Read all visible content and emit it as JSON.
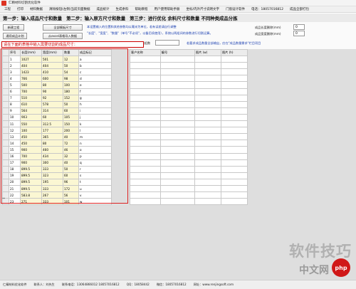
{
  "window": {
    "title": "仁精材料切割优化软件"
  },
  "menu": [
    "工程",
    "打印",
    "材料数据",
    "清除按钮(左侧)当前页面数据",
    "成品统计",
    "生成余料",
    "帮助教程",
    "用户使用帮助手册",
    "坐标/内外尺寸说明文字",
    "门窗设计软件",
    "电话：18057016812",
    "成品全部打包"
  ],
  "steps": [
    "第一步：输入成品尺寸和数量",
    "第二步：输入原方尺寸和数量",
    "第三步：进行优化 余料尺寸和数量 不同种类成品分拣"
  ],
  "controls": {
    "new_project": "新建工程",
    "import_template": "全部模板尺寸",
    "import_plan": "通用成品计划",
    "import_excel": "从excel表格导入数据",
    "desc1": "本设置输入的位置和其他参数均以毫米为单位，若有误差请自行调整",
    "desc2": "\"长度\"、\"宽度\"、\"数量\"（单号\"不必须\"，以备后续使用），系统以两组间的参数进行切割运算。",
    "cut_width_label": "成品长度删除(mm)",
    "cut_width_value": "0",
    "edge_label": "成品宽度删除(mm)",
    "edge_value": "0",
    "count_label": "成品数量组数",
    "hint": "若要求成品数量全部输出，应在\"成品数量需求\"栏目项目",
    "warn": "请在下面的表格中输入需要切割的成品尺寸："
  },
  "left_table": {
    "headers": [
      "序号",
      "长度(mm)",
      "宽度(mm)",
      "数量",
      "成品标记"
    ],
    "rows": [
      [
        "1",
        "1027",
        "501",
        "12",
        "a"
      ],
      [
        "2",
        "404",
        "404",
        "50",
        "b"
      ],
      [
        "3",
        "1423",
        "410",
        "54",
        "c"
      ],
      [
        "4",
        "766",
        "600",
        "98",
        "d"
      ],
      [
        "5",
        "500",
        "80",
        "100",
        "e"
      ],
      [
        "6",
        "700",
        "90",
        "180",
        "f"
      ],
      [
        "7",
        "510",
        "92",
        "152",
        "g"
      ],
      [
        "8",
        "610",
        "578",
        "50",
        "h"
      ],
      [
        "9",
        "564",
        "314",
        "60",
        "i"
      ],
      [
        "10",
        "903",
        "60",
        "105",
        "j"
      ],
      [
        "11",
        "550",
        "312.5",
        "150",
        "k"
      ],
      [
        "12",
        "100",
        "177",
        "200",
        "l"
      ],
      [
        "13",
        "450",
        "365",
        "40",
        "m"
      ],
      [
        "14",
        "450",
        "80",
        "72",
        "n"
      ],
      [
        "15",
        "900",
        "460",
        "46",
        "o"
      ],
      [
        "16",
        "700",
        "434",
        "32",
        "p"
      ],
      [
        "17",
        "900",
        "300",
        "40",
        "q"
      ],
      [
        "18",
        "899.5",
        "333",
        "50",
        "r"
      ],
      [
        "19",
        "899.5",
        "323",
        "60",
        "s"
      ],
      [
        "20",
        "899.5",
        "195",
        "96",
        "t"
      ],
      [
        "21",
        "899.5",
        "333",
        "172",
        "u"
      ],
      [
        "22",
        "583.8",
        "267",
        "56",
        "v"
      ],
      [
        "23",
        "271",
        "333",
        "101",
        "w"
      ]
    ],
    "end_marker": "**"
  },
  "right_table": {
    "headers": [
      "客户名称",
      "编号",
      "图片 (w)",
      "图片 (h)"
    ]
  },
  "status": [
    "仁精材料优化软件",
    "联系人：刘先生",
    "联系电话：13064866012 18057016812",
    "QQ：18058442",
    "微信：18057016812",
    "网址：www.renjingsoft.com"
  ],
  "watermark": {
    "text": "软件技巧",
    "logo_text": "php",
    "logo_sub": "中文网"
  }
}
